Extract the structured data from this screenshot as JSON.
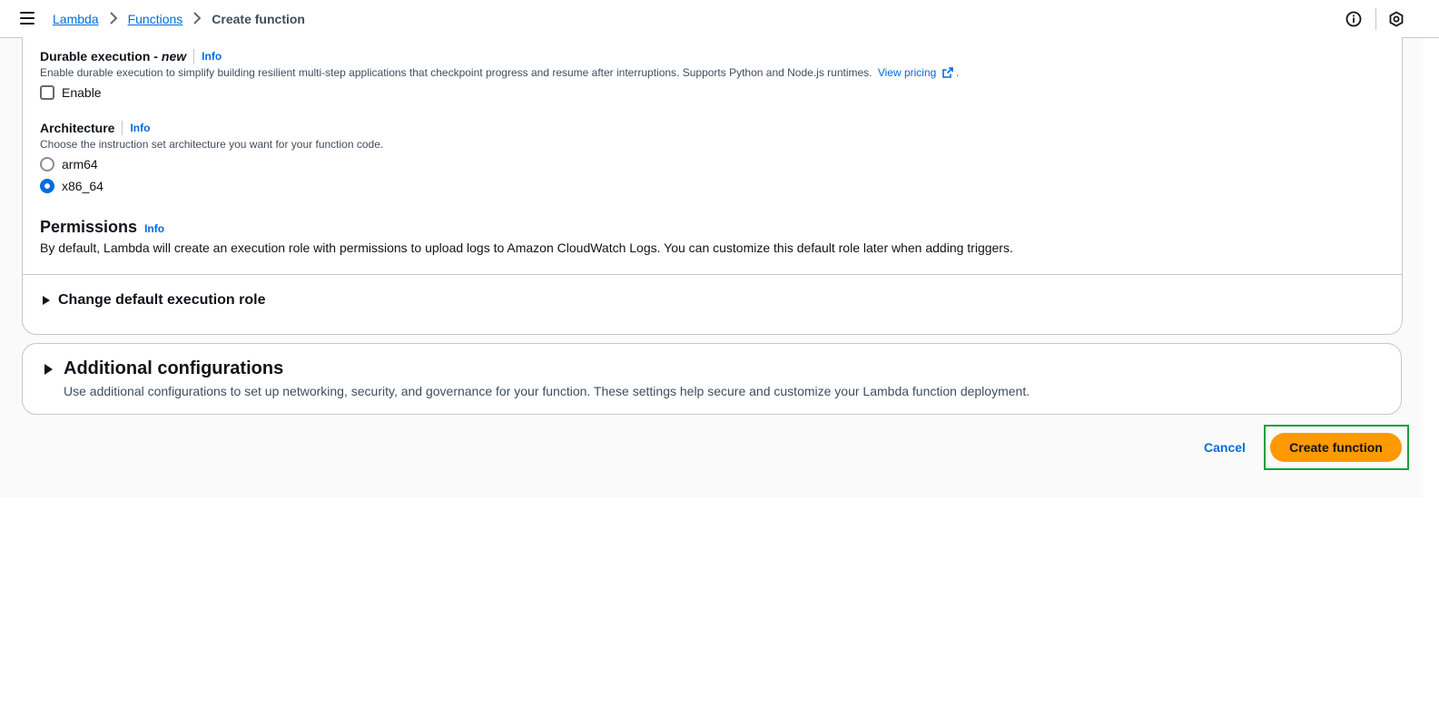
{
  "breadcrumb": {
    "items": [
      {
        "label": "Lambda"
      },
      {
        "label": "Functions"
      }
    ],
    "current": "Create function"
  },
  "top_icons": [
    "info-circle-icon",
    "settings-hex-icon"
  ],
  "durable_execution": {
    "label": "Durable execution - ",
    "label_emphasis": "new",
    "info": "Info",
    "description": "Enable durable execution to simplify building resilient multi-step applications that checkpoint progress and resume after interruptions. Supports Python and Node.js runtimes.",
    "pricing_link": "View pricing",
    "pricing_suffix": ".",
    "checkbox_label": "Enable",
    "checked": false
  },
  "architecture": {
    "label": "Architecture",
    "info": "Info",
    "description": "Choose the instruction set architecture you want for your function code.",
    "options": [
      {
        "label": "arm64",
        "selected": false
      },
      {
        "label": "x86_64",
        "selected": true
      }
    ]
  },
  "permissions": {
    "title": "Permissions",
    "info": "Info",
    "description": "By default, Lambda will create an execution role with permissions to upload logs to Amazon CloudWatch Logs. You can customize this default role later when adding triggers.",
    "expander": "Change default execution role"
  },
  "additional": {
    "title": "Additional configurations",
    "description": "Use additional configurations to set up networking, security, and governance for your function. These settings help secure and customize your Lambda function deployment."
  },
  "actions": {
    "cancel": "Cancel",
    "create": "Create function"
  },
  "colors": {
    "link": "#006ce0",
    "primary_button": "#ff9900",
    "highlight": "#1a9e3d"
  }
}
